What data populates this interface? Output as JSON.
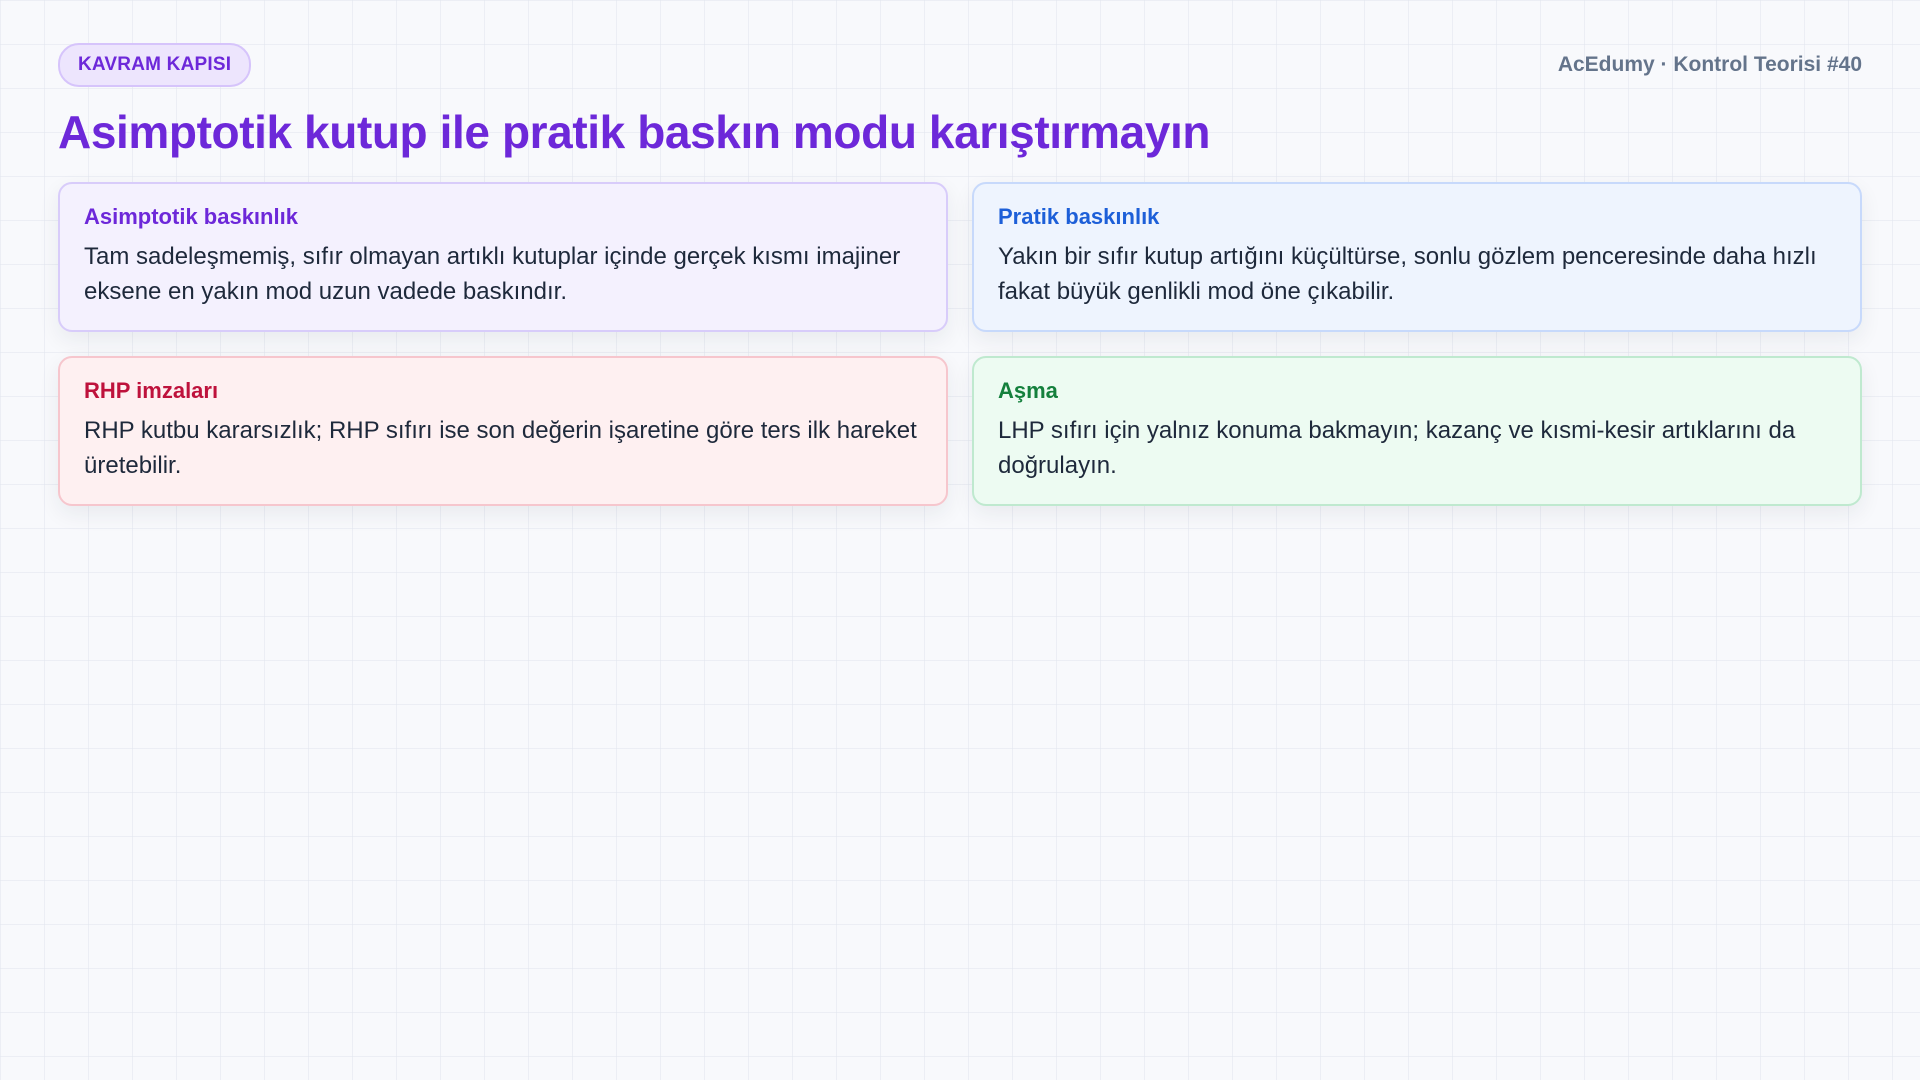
{
  "header": {
    "badge": "KAVRAM KAPISI",
    "brand": "AcEdumy · Kontrol Teorisi #40"
  },
  "title": "Asimptotik kutup ile pratik baskın modu karıştırmayın",
  "cards": [
    {
      "heading": "Asimptotik baskınlık",
      "body": "Tam sadeleşmemiş, sıfır olmayan artıklı kutuplar içinde gerçek kısmı imajiner eksene en yakın mod uzun vadede baskındır.",
      "accent": "#6d28d9"
    },
    {
      "heading": "Pratik baskınlık",
      "body": "Yakın bir sıfır kutup artığını küçültürse, sonlu gözlem penceresinde daha hızlı fakat büyük genlikli mod öne çıkabilir.",
      "accent": "#1d5fd8"
    },
    {
      "heading": "RHP imzaları",
      "body": "RHP kutbu kararsızlık; RHP sıfırı ise son değerin işaretine göre ters ilk hareket üretebilir.",
      "accent": "#be123c"
    },
    {
      "heading": "Aşma",
      "body": "LHP sıfırı için yalnız konuma bakmayın; kazanç ve kısmi-kesir artıklarını da doğrulayın.",
      "accent": "#15803d"
    }
  ]
}
